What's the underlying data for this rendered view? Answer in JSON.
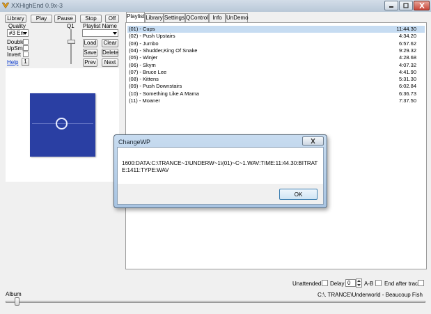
{
  "window": {
    "title": "XXHighEnd 0.9x-3"
  },
  "toolbar": {
    "library": "Library",
    "play": "Play",
    "pause": "Pause",
    "stop": "Stop",
    "off": "Off"
  },
  "controls": {
    "quality_label": "Quality",
    "q1_label": "Q1",
    "playlist_name_label": "Playlist Name",
    "quality_value": "#3 En",
    "playlist_name_value": "",
    "double_label": "Double",
    "upsmp_label": "UpSmp",
    "invert_label": "Invert",
    "help_link": "Help",
    "one_button": "1",
    "load": "Load",
    "clear": "Clear",
    "save": "Save",
    "delete": "Delete",
    "prev": "Prev",
    "next": "Next"
  },
  "tabs": [
    {
      "label": "Playlist",
      "active": true
    },
    {
      "label": "Library"
    },
    {
      "label": "Settings"
    },
    {
      "label": "QControl"
    },
    {
      "label": "Info"
    },
    {
      "label": "UnDemo"
    }
  ],
  "playlist": [
    {
      "title": "(01) - Cups",
      "duration": "11:44.30",
      "selected": true
    },
    {
      "title": "(02) - Push Upstairs",
      "duration": "4:34.20"
    },
    {
      "title": "(03) - Jumbo",
      "duration": "6:57.62"
    },
    {
      "title": "(04) - Shudder,King Of Snake",
      "duration": "9:29.32"
    },
    {
      "title": "(05) - Winjer",
      "duration": "4:28.68"
    },
    {
      "title": "(06) - Skym",
      "duration": "4:07.32"
    },
    {
      "title": "(07) - Bruce Lee",
      "duration": "4:41.90"
    },
    {
      "title": "(08) - Kittens",
      "duration": "5:31.30"
    },
    {
      "title": "(09) - Push Downstairs",
      "duration": "6:02.84"
    },
    {
      "title": "(10) - Something Like A Mama",
      "duration": "6:36.73"
    },
    {
      "title": "(11) - Moaner",
      "duration": "7:37.50"
    }
  ],
  "dialog": {
    "title": "ChangeWP",
    "message": "1600:DATA:C:\\TRANCE~1\\UNDERW~1\\(01)~C~1.WAV:TIME:11:44.30:BITRATE:1411:TYPE:WAV",
    "ok": "OK"
  },
  "bottom": {
    "unattended": "Unattended",
    "delay": "Delay",
    "delay_value": "0",
    "ab": "A-B",
    "end_after_track": "End after track",
    "album_label": "Album",
    "path": "C:\\. TRANCE\\Underworld - Beaucoup Fish"
  },
  "colors": {
    "selection": "#c6dcf2",
    "cover": "#2a3fa3"
  }
}
